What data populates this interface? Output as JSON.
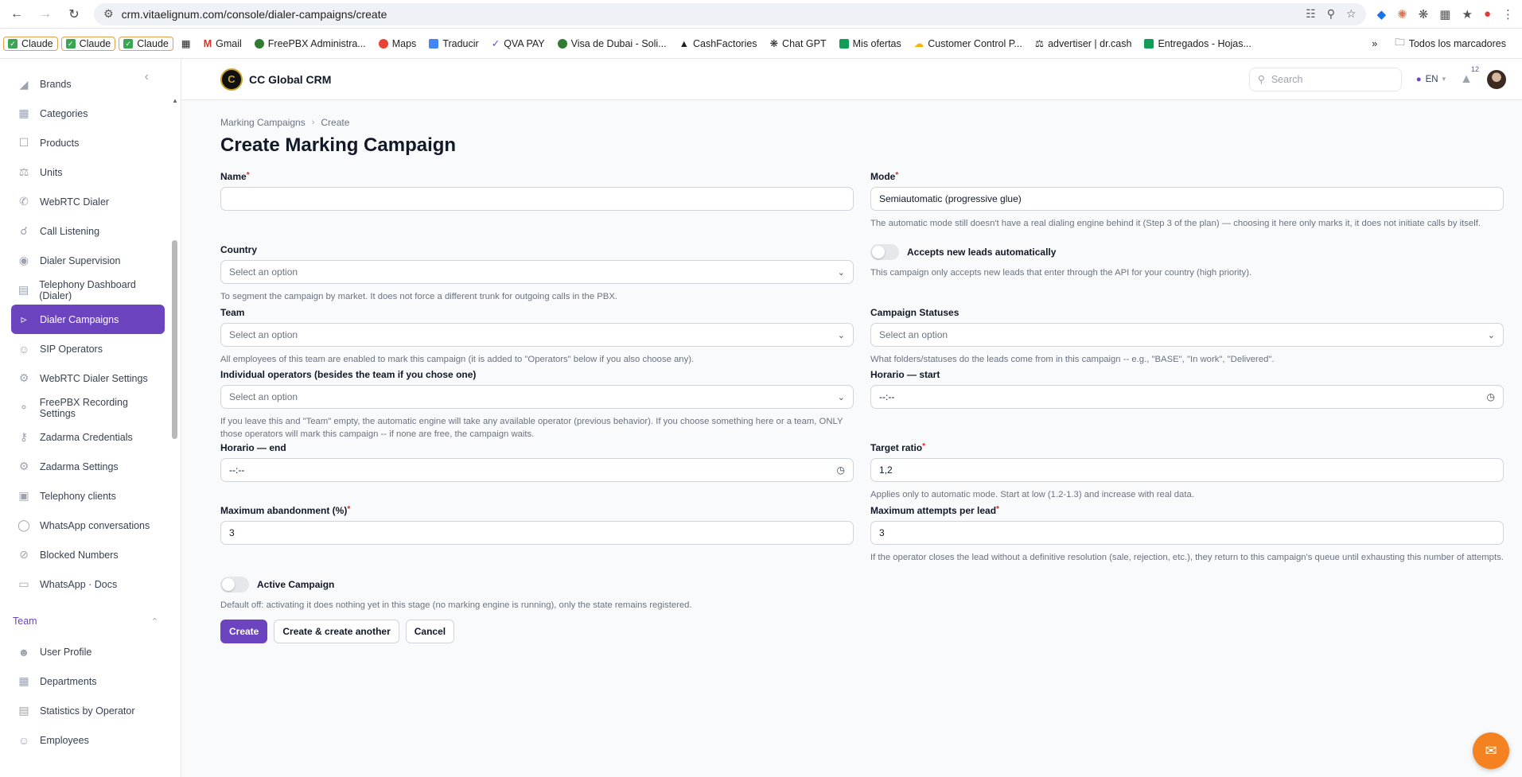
{
  "browser": {
    "url": "crm.vitaelignum.com/console/dialer-campaigns/create",
    "bookmarks": [
      {
        "label": "Claude",
        "kind": "claude"
      },
      {
        "label": "Claude",
        "kind": "claude"
      },
      {
        "label": "Claude",
        "kind": "claude"
      },
      {
        "label": "",
        "kind": "apps"
      },
      {
        "label": "Gmail",
        "kind": "gmail"
      },
      {
        "label": "FreePBX Administra...",
        "kind": "freepbx"
      },
      {
        "label": "Maps",
        "kind": "maps"
      },
      {
        "label": "Traducir",
        "kind": "translate"
      },
      {
        "label": "QVA PAY",
        "kind": "qva"
      },
      {
        "label": "Visa de Dubai - Soli...",
        "kind": "visa"
      },
      {
        "label": "CashFactories",
        "kind": "cash"
      },
      {
        "label": "Chat GPT",
        "kind": "gpt"
      },
      {
        "label": "Mis ofertas",
        "kind": "offers"
      },
      {
        "label": "Customer Control P...",
        "kind": "customer"
      },
      {
        "label": "advertiser | dr.cash",
        "kind": "drcash"
      },
      {
        "label": "Entregados - Hojas...",
        "kind": "sheets"
      }
    ],
    "all_bookmarks": "Todos los marcadores"
  },
  "sidebar": {
    "items": [
      {
        "label": "Brands",
        "icon": "tag-icon",
        "active": false
      },
      {
        "label": "Categories",
        "icon": "grid-icon",
        "active": false
      },
      {
        "label": "Products",
        "icon": "bag-icon",
        "active": false
      },
      {
        "label": "Units",
        "icon": "scale-icon",
        "active": false
      },
      {
        "label": "WebRTC Dialer",
        "icon": "phone-icon",
        "active": false
      },
      {
        "label": "Call Listening",
        "icon": "headphones-icon",
        "active": false
      },
      {
        "label": "Dialer Supervision",
        "icon": "eye-icon",
        "active": false
      },
      {
        "label": "Telephony Dashboard (Dialer)",
        "icon": "bar-chart-icon",
        "active": false
      },
      {
        "label": "Dialer Campaigns",
        "icon": "megaphone-icon",
        "active": true
      },
      {
        "label": "SIP Operators",
        "icon": "users-icon",
        "active": false
      },
      {
        "label": "WebRTC Dialer Settings",
        "icon": "gear-icon",
        "active": false
      },
      {
        "label": "FreePBX Recording Settings",
        "icon": "microphone-icon",
        "active": false
      },
      {
        "label": "Zadarma Credentials",
        "icon": "key-icon",
        "active": false
      },
      {
        "label": "Zadarma Settings",
        "icon": "gear-icon",
        "active": false
      },
      {
        "label": "Telephony clients",
        "icon": "chat-icon",
        "active": false
      },
      {
        "label": "WhatsApp conversations",
        "icon": "chat-icon",
        "active": false
      },
      {
        "label": "Blocked Numbers",
        "icon": "block-icon",
        "active": false
      },
      {
        "label": "WhatsApp · Docs",
        "icon": "book-icon",
        "active": false
      }
    ],
    "group": {
      "label": "Team"
    },
    "team_items": [
      {
        "label": "User Profile",
        "icon": "user-icon"
      },
      {
        "label": "Departments",
        "icon": "building-icon"
      },
      {
        "label": "Statistics by Operator",
        "icon": "bar-chart-icon"
      },
      {
        "label": "Employees",
        "icon": "user-circle-icon"
      }
    ]
  },
  "topbar": {
    "brand": "CC Global CRM",
    "search_placeholder": "Search",
    "lang": "EN",
    "notifications": "12"
  },
  "page": {
    "breadcrumb": [
      "Marking Campaigns",
      "Create"
    ],
    "title": "Create Marking Campaign"
  },
  "form": {
    "name": {
      "label": "Name",
      "value": ""
    },
    "mode": {
      "label": "Mode",
      "value": "Semiautomatic (progressive glue)",
      "help": "The automatic mode still doesn't have a real dialing engine behind it (Step 3 of the plan) — choosing it here only marks it, it does not initiate calls by itself."
    },
    "country": {
      "label": "Country",
      "placeholder": "Select an option",
      "help": "To segment the campaign by market. It does not force a different trunk for outgoing calls in the PBX."
    },
    "accepts_leads": {
      "label": "Accepts new leads automatically",
      "help": "This campaign only accepts new leads that enter through the API for your country (high priority)."
    },
    "team": {
      "label": "Team",
      "placeholder": "Select an option",
      "help": "All employees of this team are enabled to mark this campaign (it is added to \"Operators\" below if you also choose any)."
    },
    "statuses": {
      "label": "Campaign Statuses",
      "placeholder": "Select an option",
      "help": "What folders/statuses do the leads come from in this campaign -- e.g., \"BASE\", \"In work\", \"Delivered\"."
    },
    "operators": {
      "label": "Individual operators (besides the team if you chose one)",
      "placeholder": "Select an option",
      "help": "If you leave this and \"Team\" empty, the automatic engine will take any available operator (previous behavior). If you choose something here or a team, ONLY those operators will mark this campaign -- if none are free, the campaign waits."
    },
    "start": {
      "label": "Horario — start",
      "value": "--:--"
    },
    "end": {
      "label": "Horario — end",
      "value": "--:--"
    },
    "ratio": {
      "label": "Target ratio",
      "value": "1,2",
      "help": "Applies only to automatic mode. Start at low (1.2-1.3) and increase with real data."
    },
    "abandon": {
      "label": "Maximum abandonment (%)",
      "value": "3"
    },
    "attempts": {
      "label": "Maximum attempts per lead",
      "value": "3",
      "help": "If the operator closes the lead without a definitive resolution (sale, rejection, etc.), they return to this campaign's queue until exhausting this number of attempts."
    },
    "active": {
      "label": "Active Campaign",
      "help": "Default off: activating it does nothing yet in this stage (no marking engine is running), only the state remains registered."
    }
  },
  "buttons": {
    "create": "Create",
    "create_another": "Create & create another",
    "cancel": "Cancel"
  },
  "colors": {
    "primary": "#6d44c0",
    "chat": "#f58220"
  }
}
